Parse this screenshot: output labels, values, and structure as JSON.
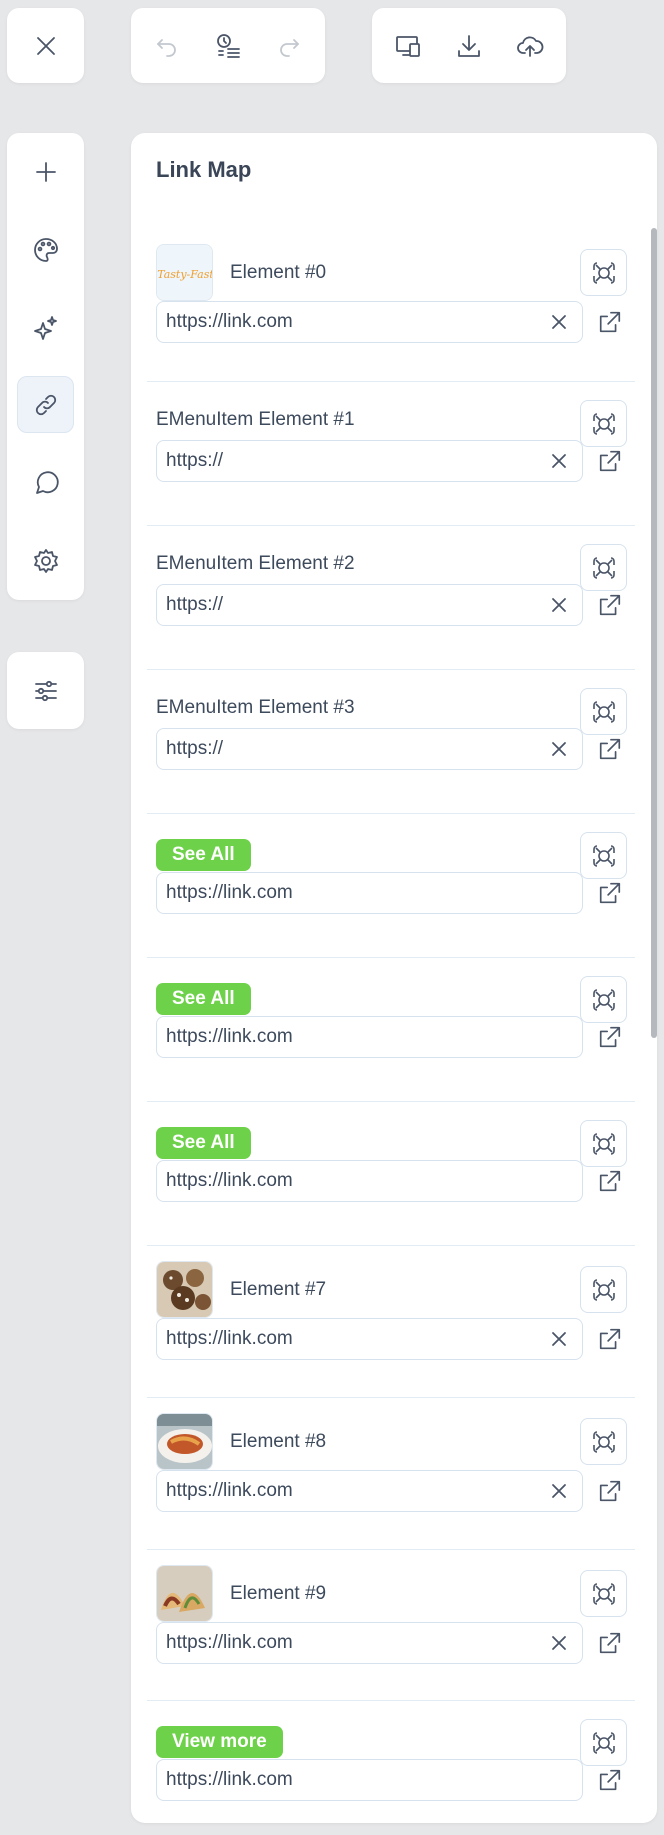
{
  "panel": {
    "title": "Link Map"
  },
  "toolbar": {
    "close": "close-icon",
    "undo": "undo-icon",
    "history": "history-icon",
    "redo": "redo-icon",
    "preview": "preview-devices-icon",
    "download": "download-icon",
    "upload": "cloud-upload-icon"
  },
  "sidebar": {
    "items": [
      {
        "icon": "plus-icon",
        "active": false
      },
      {
        "icon": "palette-icon",
        "active": false
      },
      {
        "icon": "sparkles-icon",
        "active": false
      },
      {
        "icon": "link-icon",
        "active": true
      },
      {
        "icon": "comment-icon",
        "active": false
      },
      {
        "icon": "gear-icon",
        "active": false
      }
    ],
    "settings_icon": "sliders-icon"
  },
  "links": [
    {
      "label": "Element #0",
      "kind": "thumb",
      "thumb": "logo",
      "logo_text": "Tasty-Fast",
      "url": "https://link.com",
      "clearable": true
    },
    {
      "label": "EMenuItem Element #1",
      "kind": "text",
      "url": "https://",
      "clearable": true
    },
    {
      "label": "EMenuItem Element #2",
      "kind": "text",
      "url": "https://",
      "clearable": true
    },
    {
      "label": "EMenuItem Element #3",
      "kind": "text",
      "url": "https://",
      "clearable": true
    },
    {
      "label": "See All",
      "kind": "pill",
      "url": "https://link.com",
      "clearable": false
    },
    {
      "label": "See All",
      "kind": "pill",
      "url": "https://link.com",
      "clearable": false
    },
    {
      "label": "See All",
      "kind": "pill",
      "url": "https://link.com",
      "clearable": false
    },
    {
      "label": "Element #7",
      "kind": "thumb",
      "thumb": "photo-cookies",
      "url": "https://link.com",
      "clearable": true
    },
    {
      "label": "Element #8",
      "kind": "thumb",
      "thumb": "photo-dish",
      "url": "https://link.com",
      "clearable": true
    },
    {
      "label": "Element #9",
      "kind": "thumb",
      "thumb": "photo-tacos",
      "url": "https://link.com",
      "clearable": true
    },
    {
      "label": "View more",
      "kind": "pill",
      "url": "https://link.com",
      "clearable": false
    }
  ],
  "colors": {
    "accent_green": "#6ed14a",
    "logo_orange": "#f0a030",
    "logo_green": "#6ac14a"
  }
}
